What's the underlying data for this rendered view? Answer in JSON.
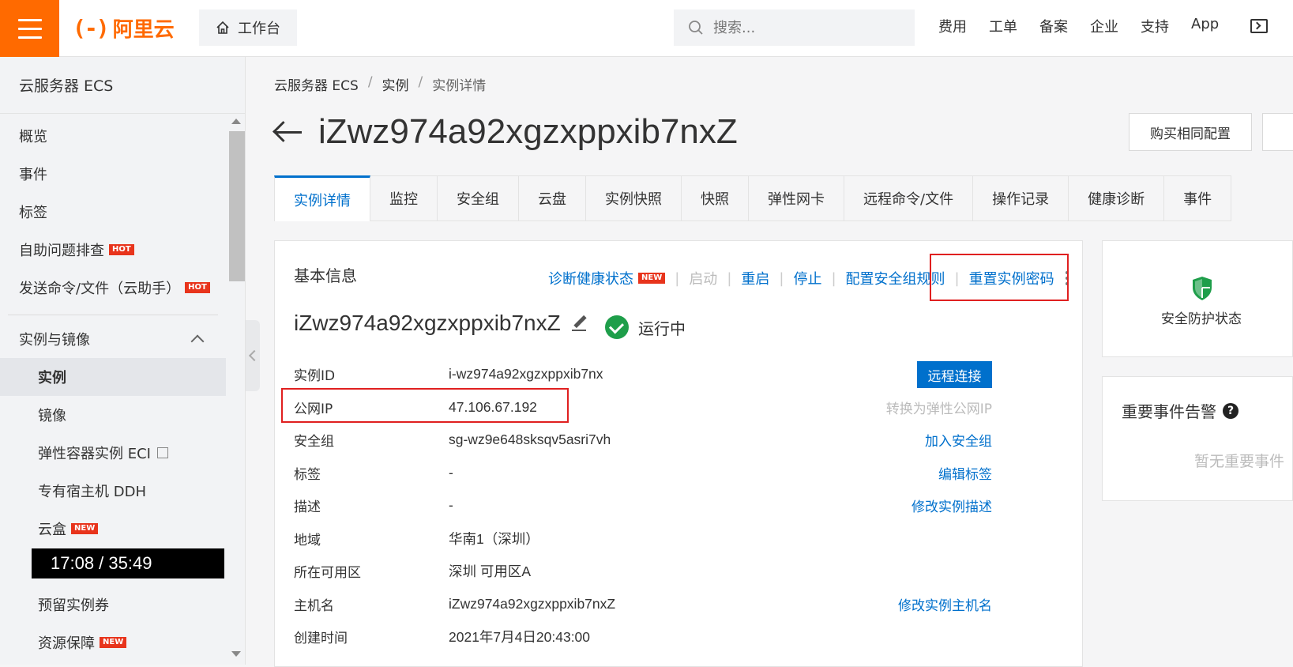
{
  "topbar": {
    "logo_text": "阿里云",
    "logo_mark": "(-)",
    "workbench": "工作台",
    "search_placeholder": "搜索...",
    "links": [
      "费用",
      "工单",
      "备案",
      "企业",
      "支持",
      "App"
    ]
  },
  "sidebar": {
    "title": "云服务器 ECS",
    "items": [
      {
        "label": "概览"
      },
      {
        "label": "事件"
      },
      {
        "label": "标签"
      },
      {
        "label": "自助问题排查",
        "badge": "HOT"
      },
      {
        "label": "发送命令/文件（云助手）",
        "badge": "HOT"
      }
    ],
    "group": "实例与镜像",
    "sub_items": [
      {
        "label": "实例",
        "active": true
      },
      {
        "label": "镜像"
      },
      {
        "label": "弹性容器实例 ECI"
      },
      {
        "label": "专有宿主机 DDH"
      },
      {
        "label": "云盒",
        "badge": "NEW"
      },
      {
        "label": "预留实例券"
      },
      {
        "label": "资源保障",
        "badge": "NEW"
      }
    ],
    "video_time": "17:08  /  35:49"
  },
  "breadcrumb": [
    "云服务器 ECS",
    "实例",
    "实例详情"
  ],
  "page_title": "iZwz974a92xgzxppxib7nxZ",
  "buy_same_button": "购买相同配置",
  "tabs": [
    "实例详情",
    "监控",
    "安全组",
    "云盘",
    "实例快照",
    "快照",
    "弹性网卡",
    "远程命令/文件",
    "操作记录",
    "健康诊断",
    "事件"
  ],
  "basic_info": {
    "title": "基本信息",
    "actions": {
      "diagnose": "诊断健康状态",
      "diagnose_badge": "NEW",
      "start": "启动",
      "restart": "重启",
      "stop": "停止",
      "config_sg": "配置安全组规则",
      "reset_pwd": "重置实例密码"
    },
    "instance_name": "iZwz974a92xgzxppxib7nxZ",
    "status": "运行中",
    "rows": [
      {
        "key": "实例ID",
        "value": "i-wz974a92xgzxppxib7nx",
        "button": "远程连接"
      },
      {
        "key": "公网IP",
        "value": "47.106.67.192",
        "op": "转换为弹性公网IP"
      },
      {
        "key": "安全组",
        "value": "sg-wz9e648sksqv5asri7vh",
        "op": "加入安全组"
      },
      {
        "key": "标签",
        "value": "-",
        "op": "编辑标签"
      },
      {
        "key": "描述",
        "value": "-",
        "op": "修改实例描述"
      },
      {
        "key": "地域",
        "value": "华南1（深圳）"
      },
      {
        "key": "所在可用区",
        "value": "深圳 可用区A"
      },
      {
        "key": "主机名",
        "value": "iZwz974a92xgzxppxib7nxZ",
        "op": "修改实例主机名"
      },
      {
        "key": "创建时间",
        "value": "2021年7月4日20:43:00"
      }
    ]
  },
  "security": {
    "label": "安全防护状态"
  },
  "alerts": {
    "title": "重要事件告警",
    "empty": "暂无重要事件"
  },
  "colors": {
    "brand": "#ff6a00",
    "link": "#0070cc",
    "running": "#1e9e4a",
    "highlight": "#e02020"
  }
}
